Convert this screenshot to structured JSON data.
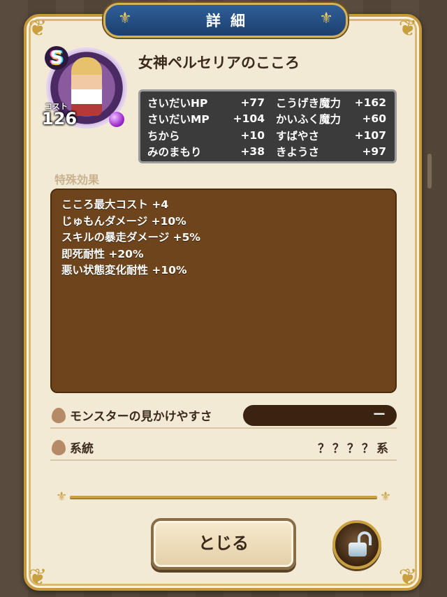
{
  "title": "詳細",
  "heart": {
    "name": "女神ペルセリアのこころ",
    "rank": "S",
    "cost_label": "コスト",
    "cost": "126"
  },
  "stats": [
    {
      "name": "さいだいHP",
      "value": "+77",
      "name2": "こうげき魔力",
      "value2": "+162"
    },
    {
      "name": "さいだいMP",
      "value": "+104",
      "name2": "かいふく魔力",
      "value2": "+60"
    },
    {
      "name": "ちから",
      "value": "+10",
      "name2": "すばやさ",
      "value2": "+107"
    },
    {
      "name": "みのまもり",
      "value": "+38",
      "name2": "きようさ",
      "value2": "+97"
    }
  ],
  "effects_label": "特殊効果",
  "effects": [
    "こころ最大コスト +4",
    "じゅもんダメージ +10%",
    "スキルの暴走ダメージ +5%",
    "即死耐性 +20%",
    "悪い状態変化耐性 +10%"
  ],
  "visibility": {
    "label": "モンスターの見かけやすさ",
    "value": "ー"
  },
  "family": {
    "label": "系統",
    "value": "？？？？系"
  },
  "buttons": {
    "close": "とじる"
  },
  "colors": {
    "panel": "#f3ead6",
    "banner": "#2f5f98",
    "effects_bg": "#6d441b",
    "stats_bg": "#3b3b3b",
    "gold": "#c9a040"
  }
}
